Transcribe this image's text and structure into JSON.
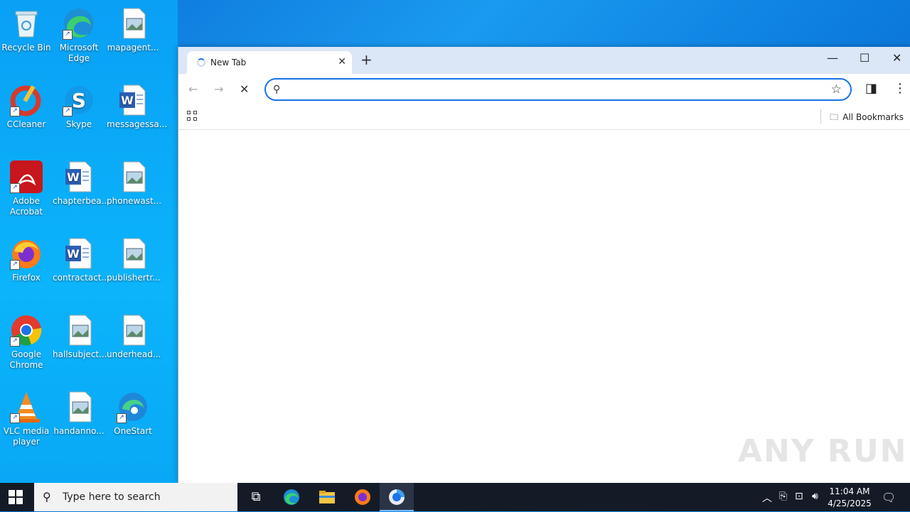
{
  "desktop": {
    "icons": [
      {
        "label": "Recycle Bin",
        "icon": "recycle-bin-icon"
      },
      {
        "label": "Microsoft Edge",
        "icon": "edge-icon"
      },
      {
        "label": "mapagent...",
        "icon": "image-file-icon"
      },
      {
        "label": "CCleaner",
        "icon": "ccleaner-icon"
      },
      {
        "label": "Skype",
        "icon": "skype-icon"
      },
      {
        "label": "messagessa...",
        "icon": "word-doc-icon"
      },
      {
        "label": "Adobe Acrobat",
        "icon": "acrobat-icon"
      },
      {
        "label": "chapterbea...",
        "icon": "word-doc-icon"
      },
      {
        "label": "phonewast...",
        "icon": "image-file-icon"
      },
      {
        "label": "Firefox",
        "icon": "firefox-icon"
      },
      {
        "label": "contractact...",
        "icon": "word-doc-icon"
      },
      {
        "label": "publishertr...",
        "icon": "image-file-icon"
      },
      {
        "label": "Google Chrome",
        "icon": "chrome-icon"
      },
      {
        "label": "hallsubject...",
        "icon": "image-file-icon"
      },
      {
        "label": "underhead...",
        "icon": "image-file-icon"
      },
      {
        "label": "VLC media player",
        "icon": "vlc-icon"
      },
      {
        "label": "handanno...",
        "icon": "image-file-icon"
      },
      {
        "label": "OneStart",
        "icon": "onestart-icon"
      }
    ]
  },
  "browser": {
    "tab_title": "New Tab",
    "address_value": "",
    "bookmarks_label": "All Bookmarks"
  },
  "watermark": "ANY RUN",
  "taskbar": {
    "search_placeholder": "Type here to search",
    "time": "11:04 AM",
    "date": "4/25/2025"
  },
  "colors": {
    "accent": "#1a73e8",
    "tabbar": "#dbe6f6",
    "taskbar": "#141b27"
  }
}
